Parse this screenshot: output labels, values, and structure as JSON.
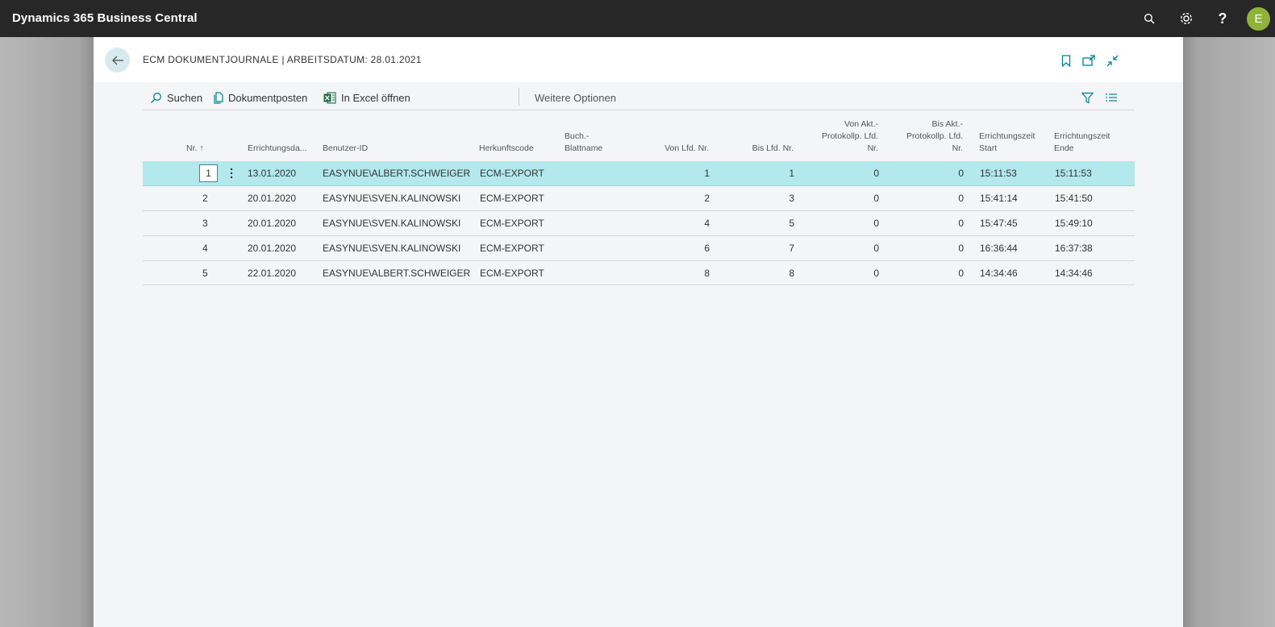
{
  "app": {
    "title": "Dynamics 365 Business Central",
    "user_initial": "E"
  },
  "page": {
    "title": "ECM DOKUMENTJOURNALE | ARBEITSDATUM: 28.01.2021"
  },
  "actions": {
    "search": "Suchen",
    "document_entries": "Dokumentposten",
    "open_excel": "In Excel öffnen",
    "more_options": "Weitere Optionen"
  },
  "columns": {
    "nr": "Nr. ↑",
    "creation_date": "Errichtungsda...",
    "user_id": "Benutzer-ID",
    "source_code": "Herkunftscode",
    "batch_name_1": "Buch.-",
    "batch_name_2": "Blattname",
    "from_seq": "Von Lfd. Nr.",
    "to_seq": "Bis Lfd. Nr.",
    "from_log_1": "Von Akt.-",
    "from_log_2": "Protokollp. Lfd.",
    "from_log_3": "Nr.",
    "to_log_1": "Bis Akt.-",
    "to_log_2": "Protokollp. Lfd.",
    "to_log_3": "Nr.",
    "start_time_1": "Errichtungszeit",
    "start_time_2": "Start",
    "end_time_1": "Errichtungszeit",
    "end_time_2": "Ende"
  },
  "rows": [
    {
      "nr": "1",
      "date": "13.01.2020",
      "user": "EASYNUE\\ALBERT.SCHWEIGER",
      "source": "ECM-EXPORT",
      "batch": "",
      "from_seq": "1",
      "to_seq": "1",
      "from_log": "0",
      "to_log": "0",
      "start": "15:11:53",
      "end": "15:11:53"
    },
    {
      "nr": "2",
      "date": "20.01.2020",
      "user": "EASYNUE\\SVEN.KALINOWSKI",
      "source": "ECM-EXPORT",
      "batch": "",
      "from_seq": "2",
      "to_seq": "3",
      "from_log": "0",
      "to_log": "0",
      "start": "15:41:14",
      "end": "15:41:50"
    },
    {
      "nr": "3",
      "date": "20.01.2020",
      "user": "EASYNUE\\SVEN.KALINOWSKI",
      "source": "ECM-EXPORT",
      "batch": "",
      "from_seq": "4",
      "to_seq": "5",
      "from_log": "0",
      "to_log": "0",
      "start": "15:47:45",
      "end": "15:49:10"
    },
    {
      "nr": "4",
      "date": "20.01.2020",
      "user": "EASYNUE\\SVEN.KALINOWSKI",
      "source": "ECM-EXPORT",
      "batch": "",
      "from_seq": "6",
      "to_seq": "7",
      "from_log": "0",
      "to_log": "0",
      "start": "16:36:44",
      "end": "16:37:38"
    },
    {
      "nr": "5",
      "date": "22.01.2020",
      "user": "EASYNUE\\ALBERT.SCHWEIGER",
      "source": "ECM-EXPORT",
      "batch": "",
      "from_seq": "8",
      "to_seq": "8",
      "from_log": "0",
      "to_log": "0",
      "start": "14:34:46",
      "end": "14:34:46"
    }
  ],
  "colors": {
    "topbar": "#272727",
    "accent": "#00838f",
    "selected_row": "#b3e8ec",
    "avatar": "#8fb33a",
    "excel": "#1e7145"
  }
}
